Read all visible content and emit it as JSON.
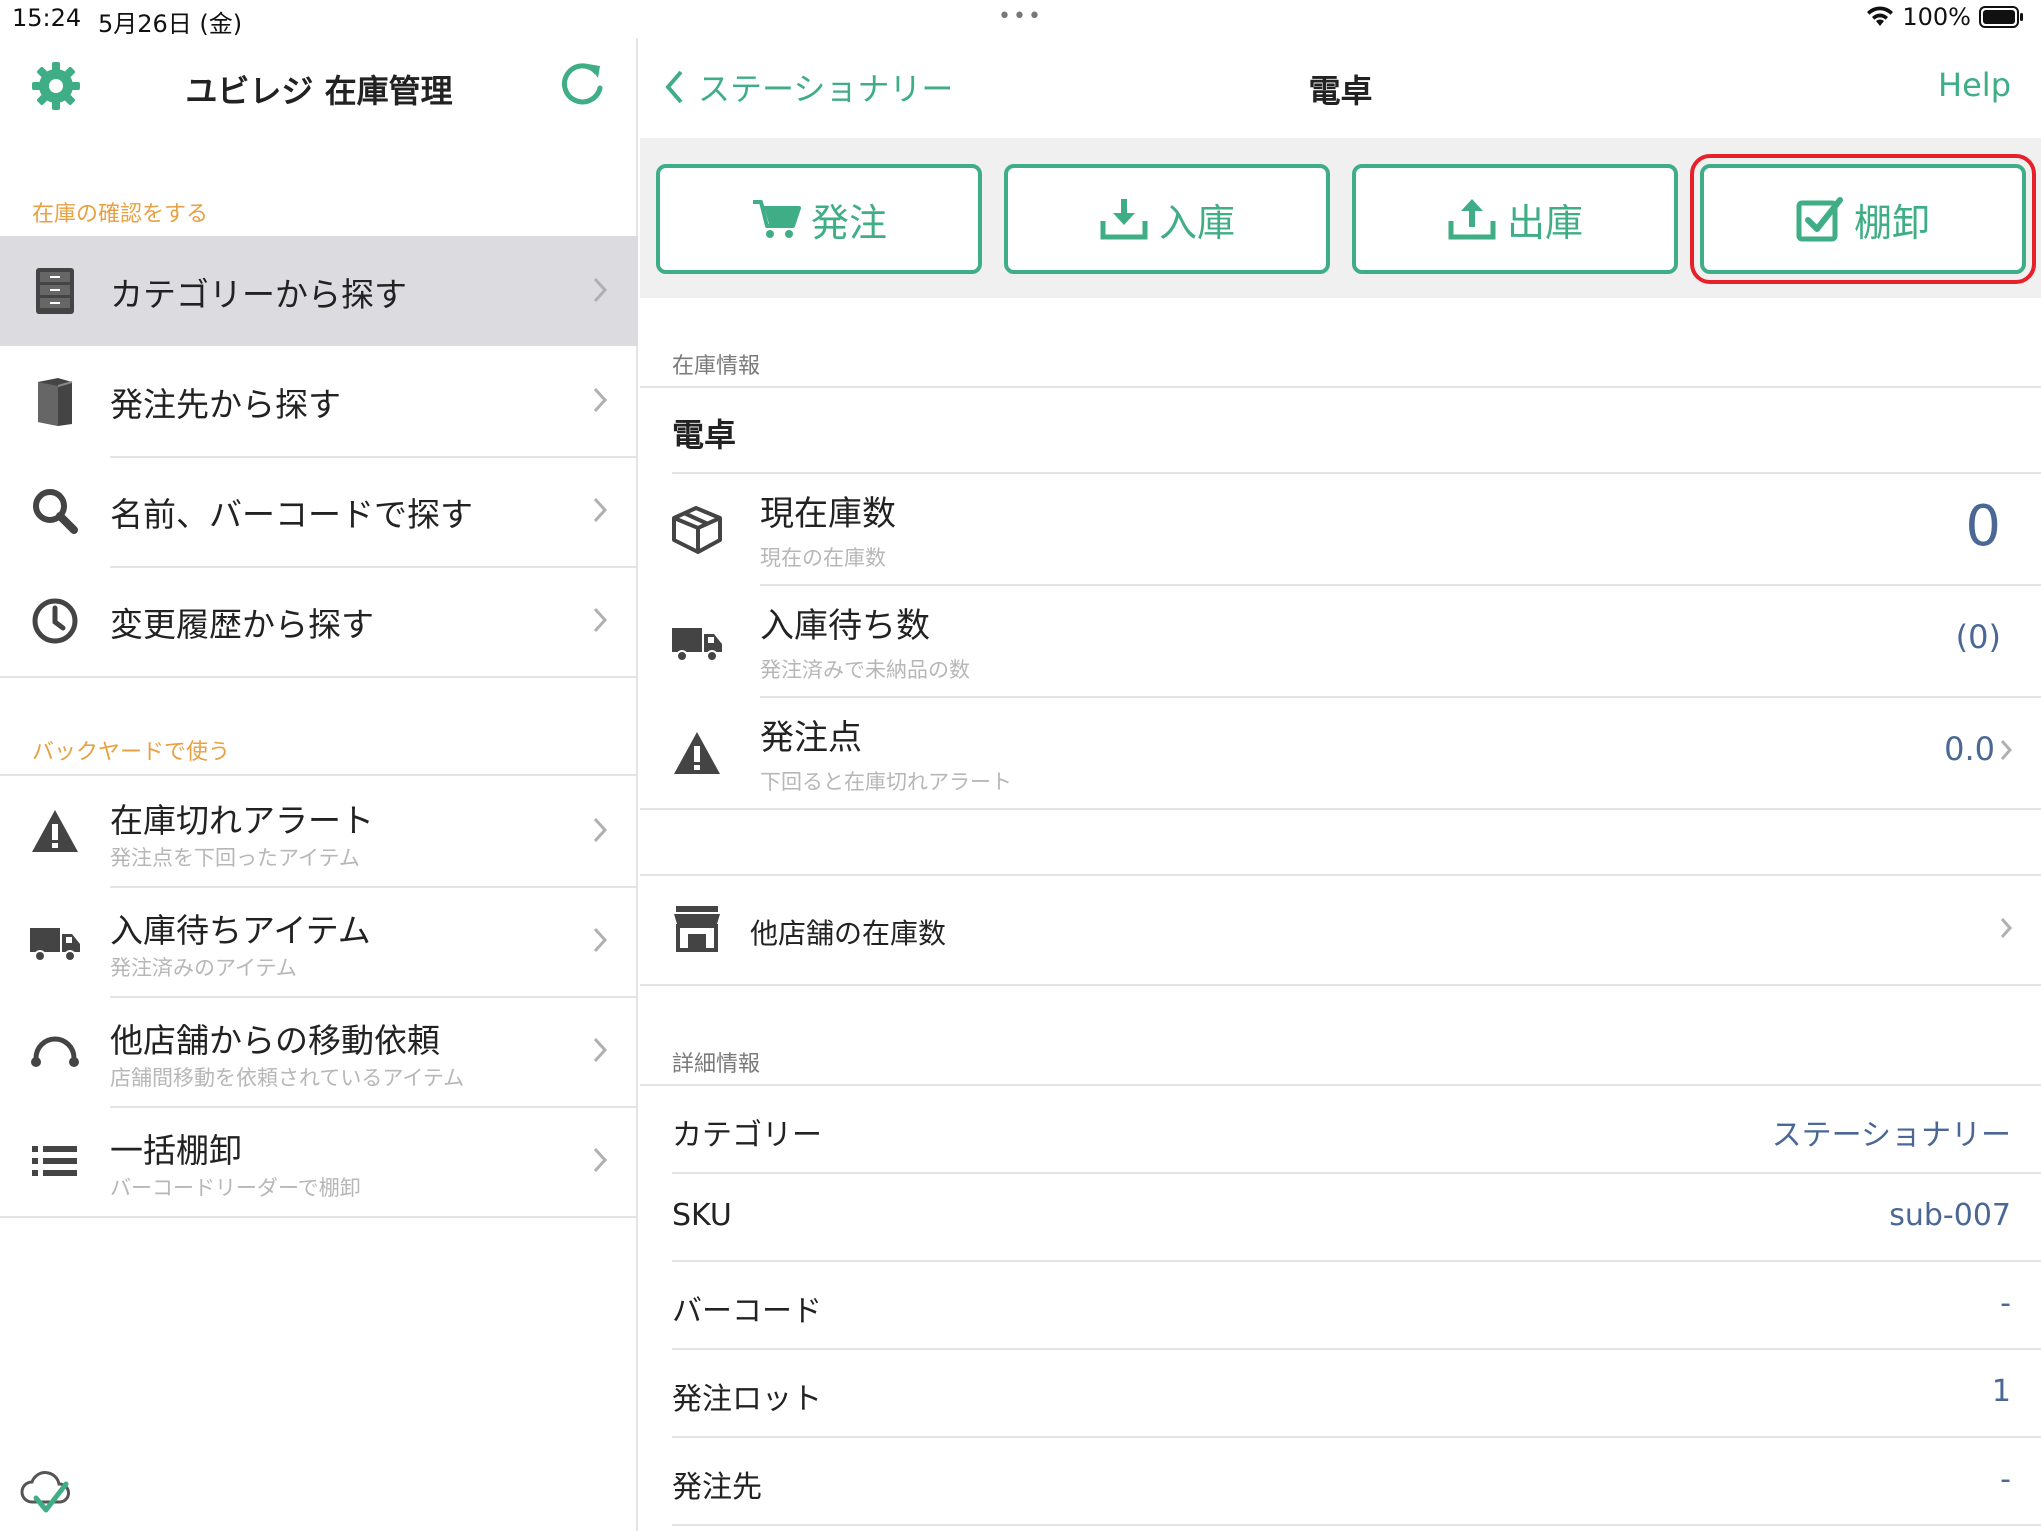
{
  "status_bar": {
    "time": "15:24",
    "date": "5月26日 (金)",
    "multitask": "•••",
    "battery": "100%"
  },
  "sidebar": {
    "title": "ユビレジ 在庫管理",
    "section_check": "在庫の確認をする",
    "check_items": [
      {
        "label": "カテゴリーから探す",
        "icon": "cabinet-icon",
        "selected": true
      },
      {
        "label": "発注先から探す",
        "icon": "book-icon"
      },
      {
        "label": "名前、バーコードで探す",
        "icon": "search-icon"
      },
      {
        "label": "変更履歴から探す",
        "icon": "clock-icon"
      }
    ],
    "section_backyard": "バックヤードで使う",
    "backyard_items": [
      {
        "label": "在庫切れアラート",
        "sub": "発注点を下回ったアイテム",
        "icon": "warning-icon"
      },
      {
        "label": "入庫待ちアイテム",
        "sub": "発注済みのアイテム",
        "icon": "truck-icon"
      },
      {
        "label": "他店舗からの移動依頼",
        "sub": "店舗間移動を依頼されているアイテム",
        "icon": "transfer-icon"
      },
      {
        "label": "一括棚卸",
        "sub": "バーコードリーダーで棚卸",
        "icon": "list-icon"
      }
    ]
  },
  "nav": {
    "back_label": "ステーショナリー",
    "title": "電卓",
    "help_label": "Help"
  },
  "toolbar": {
    "order_label": "発注",
    "receive_label": "入庫",
    "ship_label": "出庫",
    "inventory_label": "棚卸"
  },
  "stock_info": {
    "section_label": "在庫情報",
    "item_name": "電卓",
    "current_title": "現在庫数",
    "current_sub": "現在の在庫数",
    "current_value": "0",
    "incoming_title": "入庫待ち数",
    "incoming_sub": "発注済みで未納品の数",
    "incoming_value": "(0)",
    "reorder_title": "発注点",
    "reorder_sub": "下回ると在庫切れアラート",
    "reorder_value": "0.0",
    "other_stores_label": "他店舗の在庫数"
  },
  "details": {
    "section_label": "詳細情報",
    "rows": [
      {
        "key": "カテゴリー",
        "value": "ステーショナリー"
      },
      {
        "key": "SKU",
        "value": "sub-007"
      },
      {
        "key": "バーコード",
        "value": "-"
      },
      {
        "key": "発注ロット",
        "value": "1"
      },
      {
        "key": "発注先",
        "value": "-"
      }
    ]
  },
  "colors": {
    "accent": "#3fae86",
    "section_orange": "#e8a142",
    "value_blue": "#4a6796",
    "highlight_red": "#e8202a",
    "selected_row": "#dcdce0"
  }
}
